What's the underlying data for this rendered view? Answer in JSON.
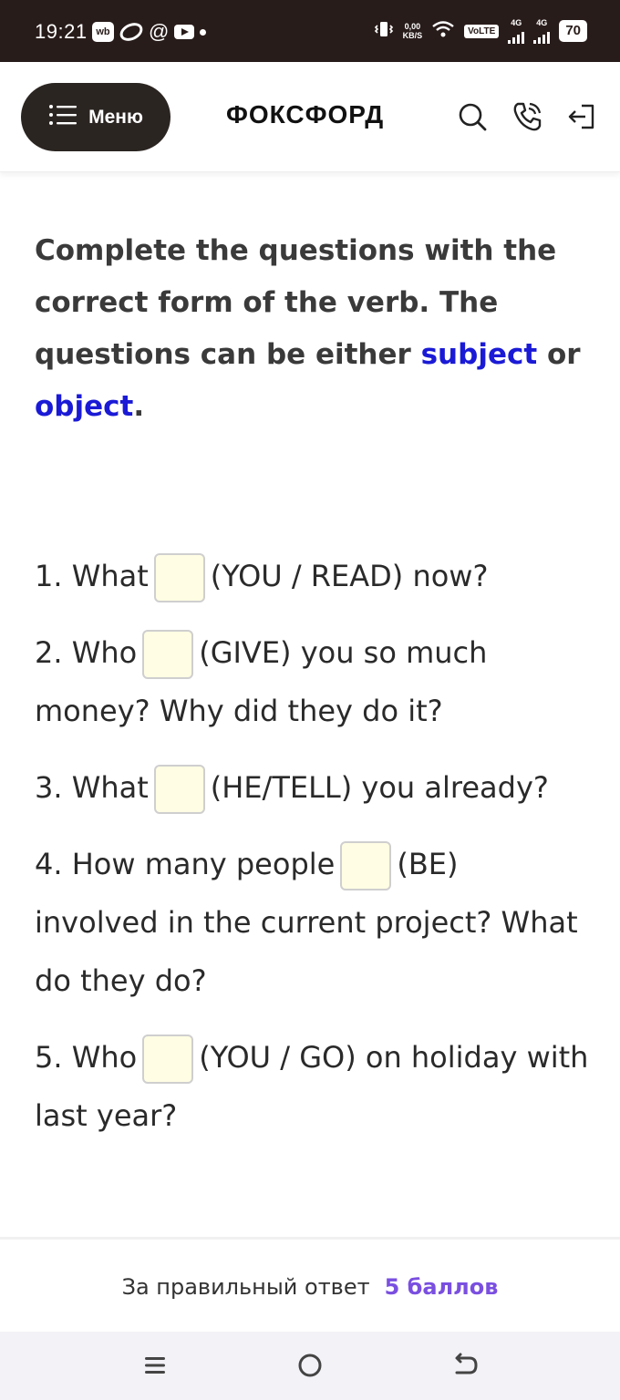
{
  "status_bar": {
    "time": "19:21",
    "wb_badge": "wb",
    "at_symbol": "@",
    "net_speed_value": "0,00",
    "net_speed_unit": "KB/S",
    "volte": "VoLTE",
    "network_1": "4G",
    "network_2": "4G",
    "battery": "70"
  },
  "header": {
    "menu_label": "Меню",
    "logo": "ФОКСФОРД",
    "icons": [
      "search-icon",
      "phone-icon",
      "login-icon"
    ]
  },
  "task": {
    "text_main": "Complete the questions with the correct form of the verb. The questions can be either ",
    "keyword_1": "subject",
    "connector": " or ",
    "keyword_2": "object",
    "end": "."
  },
  "questions": [
    {
      "before": "1. What",
      "after": "(YOU / READ) now?"
    },
    {
      "before": "2. Who",
      "after": "(GIVE) you so much money? Why did they do it?"
    },
    {
      "before": "3. What",
      "after": "(HE/TELL) you already?"
    },
    {
      "before": "4. How many people",
      "after": "(BE) involved in the current project? What do they do?"
    },
    {
      "before": "5. Who",
      "after": "(YOU / GO) on holiday with last year?"
    }
  ],
  "points": {
    "label": "За правильный ответ",
    "value": "5 баллов"
  },
  "colors": {
    "status_bar": "#281c1a",
    "menu_button": "#2b2522",
    "keyword": "#1a1ad6",
    "points_value": "#7a4fe0",
    "gap_fill": "#fffde3"
  }
}
